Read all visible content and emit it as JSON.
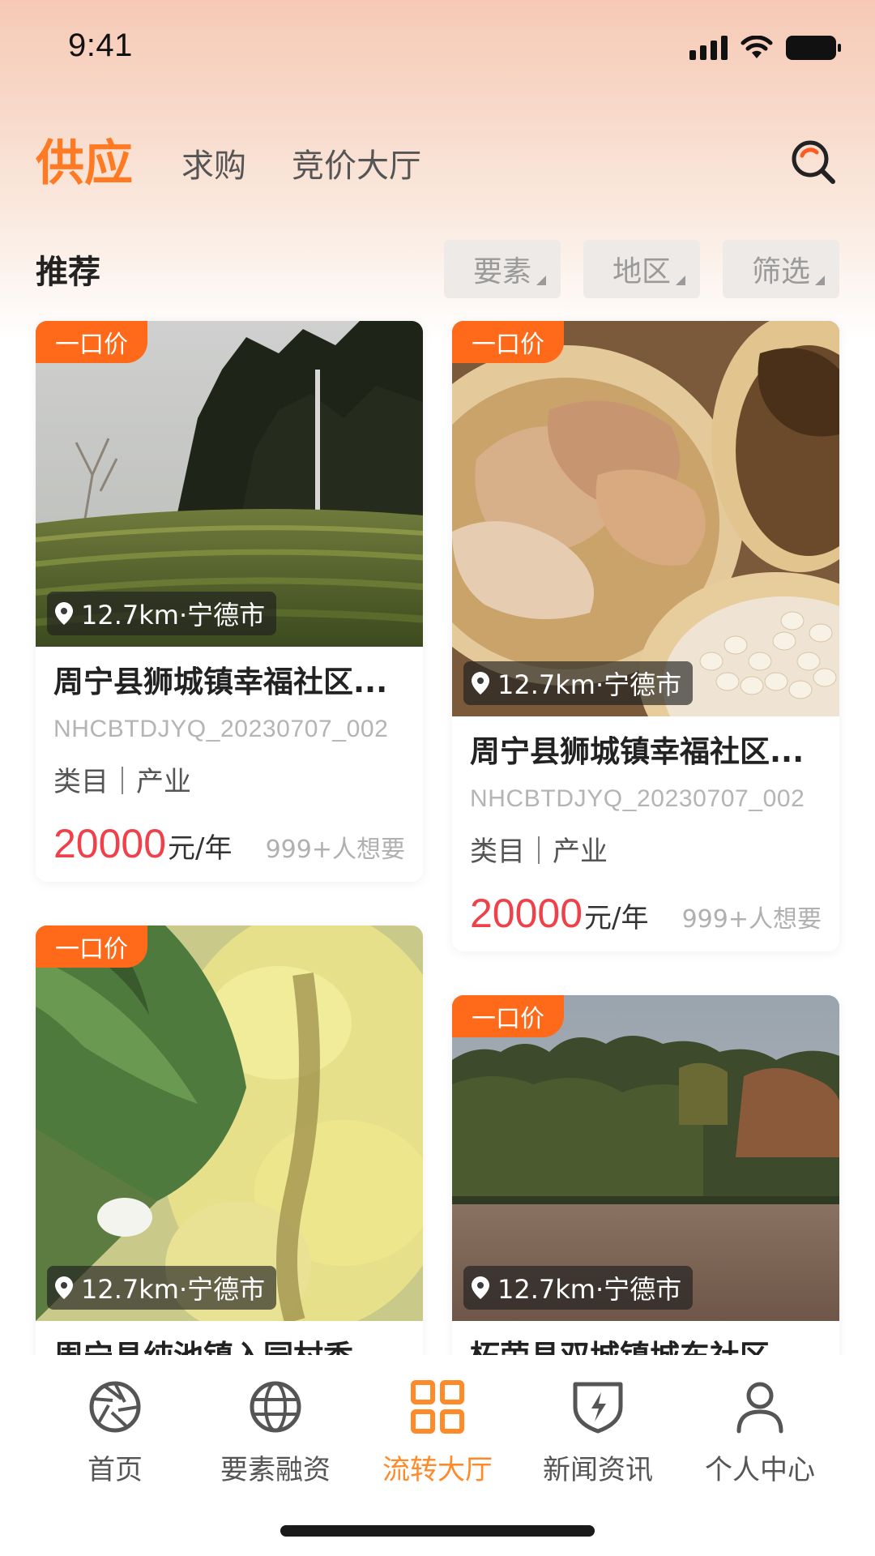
{
  "status_bar": {
    "time": "9:41"
  },
  "top_tabs": [
    {
      "label": "供应",
      "active": true
    },
    {
      "label": "求购",
      "active": false
    },
    {
      "label": "竞价大厅",
      "active": false
    }
  ],
  "section": {
    "title": "推荐"
  },
  "filters": [
    {
      "label": "要素"
    },
    {
      "label": "地区"
    },
    {
      "label": "筛选"
    }
  ],
  "cards": [
    {
      "badge": "一口价",
      "location": "12.7km·宁德市",
      "title": "周宁县狮城镇幸福社区...",
      "code": "NHCBTDJYQ_20230707_002",
      "category": "类目｜产业",
      "price": "20000",
      "unit": "元/年",
      "wants": "999+人想要"
    },
    {
      "badge": "一口价",
      "location": "12.7km·宁德市",
      "title": "周宁县狮城镇幸福社区...",
      "code": "NHCBTDJYQ_20230707_002",
      "category": "类目｜产业",
      "price": "20000",
      "unit": "元/年",
      "wants": "999+人想要"
    },
    {
      "badge": "一口价",
      "location": "12.7km·宁德市",
      "title": "周宁县纯池镇入园村香...",
      "code": "",
      "category": "",
      "price": "",
      "unit": "",
      "wants": ""
    },
    {
      "badge": "一口价",
      "location": "12.7km·宁德市",
      "title": "柘荣县双城镇城东社区...",
      "code": "",
      "category": "",
      "price": "",
      "unit": "",
      "wants": ""
    }
  ],
  "bottom_nav": [
    {
      "label": "首页",
      "icon": "aperture-icon",
      "active": false
    },
    {
      "label": "要素融资",
      "icon": "globe-icon",
      "active": false
    },
    {
      "label": "流转大厅",
      "icon": "grid-icon",
      "active": true
    },
    {
      "label": "新闻资讯",
      "icon": "shield-bolt-icon",
      "active": false
    },
    {
      "label": "个人中心",
      "icon": "person-icon",
      "active": false
    }
  ],
  "colors": {
    "accent": "#ff7a22",
    "badge": "#ff6a1a",
    "price": "#f0404a",
    "nav_active": "#ff8a2a"
  }
}
